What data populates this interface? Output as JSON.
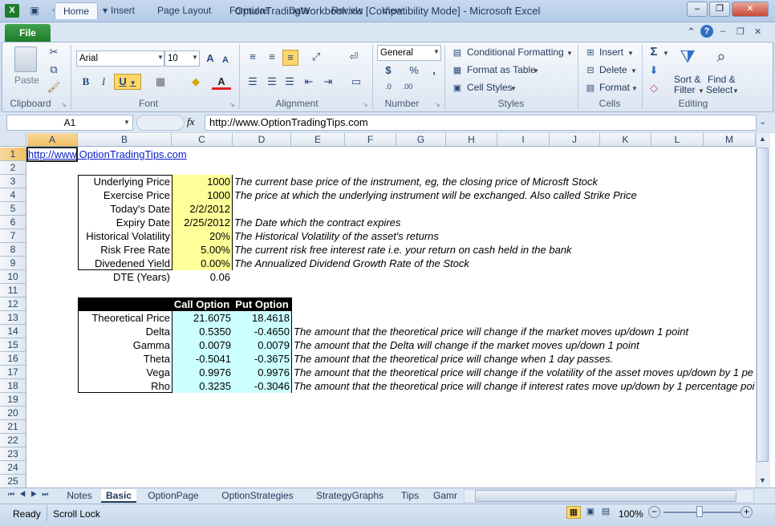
{
  "window": {
    "title": "OptionTradingWorkbook.xls  [Compatibility Mode]  -  Microsoft Excel",
    "minimize": "–",
    "restore": "❐",
    "close": "✕"
  },
  "ribbon_tabs": [
    "Home",
    "Insert",
    "Page Layout",
    "Formulas",
    "Data",
    "Review",
    "View"
  ],
  "file_tab": "File",
  "clipboard": {
    "paste": "Paste",
    "label": "Clipboard"
  },
  "font": {
    "name": "Arial",
    "size": "10",
    "label": "Font",
    "bold": "B",
    "italic": "I",
    "underline": "U",
    "font_color_glyph": "A"
  },
  "alignment": {
    "label": "Alignment"
  },
  "number": {
    "format": "General",
    "label": "Number",
    "currency": "$",
    "percent": "%",
    "comma": ","
  },
  "styles": {
    "conditional": "Conditional Formatting",
    "table": "Format as Table",
    "cell_styles": "Cell Styles",
    "label": "Styles"
  },
  "cells": {
    "insert": "Insert",
    "delete": "Delete",
    "format": "Format",
    "label": "Cells"
  },
  "editing": {
    "sum": "Σ",
    "sort": "Sort &",
    "filter": "Filter",
    "find": "Find &",
    "select": "Select",
    "label": "Editing"
  },
  "formula_bar": {
    "name_box": "A1",
    "fx": "fx",
    "content": "http://www.OptionTradingTips.com"
  },
  "columns": [
    "A",
    "B",
    "C",
    "D",
    "E",
    "F",
    "G",
    "H",
    "I",
    "J",
    "K",
    "L",
    "M"
  ],
  "rows": [
    "1",
    "2",
    "3",
    "4",
    "5",
    "6",
    "7",
    "8",
    "9",
    "10",
    "11",
    "12",
    "13",
    "14",
    "15",
    "16",
    "17",
    "18",
    "19",
    "20",
    "21",
    "22",
    "23",
    "24",
    "25"
  ],
  "sheet": {
    "a1": "http://www.OptionTradingTips.com",
    "inputs": [
      {
        "label": "Underlying Price",
        "value": "1000",
        "note": "The current base price of the instrument, eg, the closing price of Microsft Stock"
      },
      {
        "label": "Exercise Price",
        "value": "1000",
        "note": "The price at which the underlying instrument will be exchanged. Also called Strike Price"
      },
      {
        "label": "Today's Date",
        "value": "2/2/2012",
        "note": ""
      },
      {
        "label": "Expiry Date",
        "value": "2/25/2012",
        "note": "The Date which the contract expires"
      },
      {
        "label": "Historical Volatility",
        "value": "20%",
        "note": "The Historical Volatility of the asset's returns"
      },
      {
        "label": "Risk Free Rate",
        "value": "5.00%",
        "note": "The current risk free interest rate i.e. your return on cash held in the bank"
      },
      {
        "label": "Divedened Yield",
        "value": "0.00%",
        "note": "The Annualized Dividend Growth Rate of the Stock"
      }
    ],
    "dte_label": "DTE (Years)",
    "dte_value": "0.06",
    "out_header_call": "Call Option",
    "out_header_put": "Put Option",
    "outputs": [
      {
        "label": "Theoretical Price",
        "call": "21.6075",
        "put": "18.4618",
        "note": ""
      },
      {
        "label": "Delta",
        "call": "0.5350",
        "put": "-0.4650",
        "note": "The amount that the theoretical price will change if the market moves up/down 1 point"
      },
      {
        "label": "Gamma",
        "call": "0.0079",
        "put": "0.0079",
        "note": "The amount that the Delta will change if the market moves up/down 1 point"
      },
      {
        "label": "Theta",
        "call": "-0.5041",
        "put": "-0.3675",
        "note": "The amount that the theoretical price will change when 1 day passes."
      },
      {
        "label": "Vega",
        "call": "0.9976",
        "put": "0.9976",
        "note": "The amount that the theoretical price will change if the volatility of the asset moves up/down by 1 pe"
      },
      {
        "label": "Rho",
        "call": "0.3235",
        "put": "-0.3046",
        "note": "The amount that the theoretical price will change if interest rates move up/down by 1 percentage poi"
      }
    ]
  },
  "sheet_tabs": [
    "Notes",
    "Basic",
    "OptionPage",
    "OptionStrategies",
    "StrategyGraphs",
    "Tips",
    "Gamr"
  ],
  "active_sheet": "Basic",
  "status": {
    "ready": "Ready",
    "scroll_lock": "Scroll Lock",
    "zoom": "100%"
  }
}
